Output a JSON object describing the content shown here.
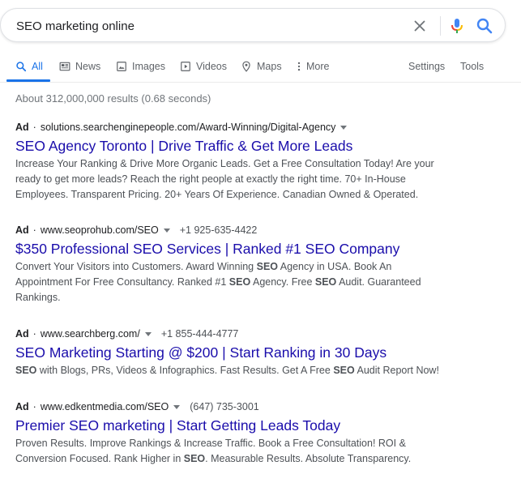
{
  "search": {
    "query": "SEO marketing online",
    "clear_icon": "close-icon",
    "mic_icon": "microphone-icon",
    "search_icon": "search-icon"
  },
  "tabs": [
    {
      "label": "All",
      "icon": "search-icon",
      "active": true
    },
    {
      "label": "News",
      "icon": "news-icon"
    },
    {
      "label": "Images",
      "icon": "image-icon"
    },
    {
      "label": "Videos",
      "icon": "video-icon"
    },
    {
      "label": "Maps",
      "icon": "map-pin-icon"
    },
    {
      "label": "More",
      "icon": "more-vertical-icon"
    }
  ],
  "tools": {
    "settings": "Settings",
    "tools": "Tools"
  },
  "stats": "About 312,000,000 results (0.68 seconds)",
  "colors": {
    "link": "#1a0dab",
    "accent": "#1a73e8",
    "text": "#202124",
    "muted": "#4d5156",
    "mic_blue": "#4285f4",
    "mic_red": "#ea4335",
    "mic_yellow": "#fbbc05",
    "mic_green": "#34a853"
  },
  "ads": [
    {
      "label": "Ad",
      "url": "solutions.searchenginepeople.com/Award-Winning/Digital-Agency",
      "phone": "",
      "title": "SEO Agency Toronto | Drive Traffic & Get More Leads",
      "desc": [
        "Increase Your Ranking & Drive More Organic Leads. Get a Free Consultation Today! Are your",
        "ready to get more leads? Reach the right people at exactly the right time. 70+ In-House",
        "Employees. Transparent Pricing. 20+ Years Of Experience. Canadian Owned & Operated."
      ]
    },
    {
      "label": "Ad",
      "url": "www.seoprohub.com/SEO",
      "phone": "+1 925-635-4422",
      "title": "$350 Professional SEO Services | Ranked #1 SEO Company",
      "desc_parts": [
        [
          [
            "Convert Your Visitors into Customers. Award Winning ",
            false
          ],
          [
            "SEO",
            true
          ],
          [
            " Agency in USA. Book An",
            false
          ]
        ],
        [
          [
            "Appointment For Free Consultancy. Ranked #1 ",
            false
          ],
          [
            "SEO",
            true
          ],
          [
            " Agency. Free ",
            false
          ],
          [
            "SEO",
            true
          ],
          [
            " Audit. Guaranteed",
            false
          ]
        ],
        [
          [
            "Rankings.",
            false
          ]
        ]
      ]
    },
    {
      "label": "Ad",
      "url": "www.searchberg.com/",
      "phone": "+1 855-444-4777",
      "title": "SEO Marketing Starting @ $200 | Start Ranking in 30 Days",
      "desc_parts": [
        [
          [
            "SEO",
            true
          ],
          [
            " with Blogs, PRs, Videos & Infographics. Fast Results. Get A Free ",
            false
          ],
          [
            "SEO",
            true
          ],
          [
            " Audit Report Now!",
            false
          ]
        ]
      ]
    },
    {
      "label": "Ad",
      "url": "www.edkentmedia.com/SEO",
      "phone": "(647) 735-3001",
      "title": "Premier SEO marketing | Start Getting Leads Today",
      "desc_parts": [
        [
          [
            "Proven Results. Improve Rankings & Increase Traffic. Book a Free Consultation! ROI &",
            false
          ]
        ],
        [
          [
            "Conversion Focused. Rank Higher in ",
            false
          ],
          [
            "SEO",
            true
          ],
          [
            ". Measurable Results. Absolute Transparency.",
            false
          ]
        ]
      ]
    }
  ]
}
